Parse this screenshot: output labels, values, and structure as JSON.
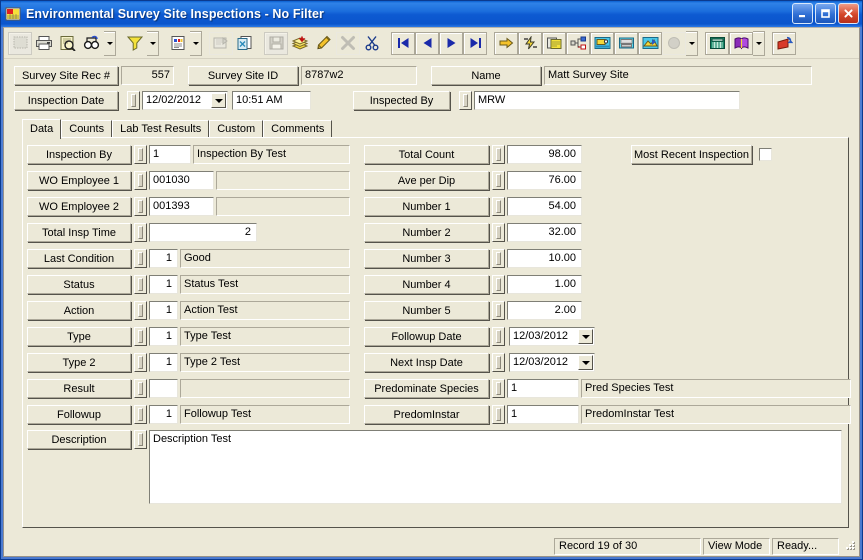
{
  "window": {
    "title": "Environmental Survey Site Inspections - No Filter",
    "app_icon": "app-window-icon",
    "minimize_label": "Minimize",
    "maximize_label": "Maximize",
    "close_label": "Close"
  },
  "toolbar": {
    "buttons": [
      {
        "name": "new-record-icon",
        "glyph": "blank-page",
        "disabled": true
      },
      {
        "name": "print-icon",
        "glyph": "printer",
        "disabled": false
      },
      {
        "name": "print-preview-icon",
        "glyph": "preview",
        "disabled": false
      },
      {
        "name": "find-icon",
        "glyph": "binoculars",
        "disabled": false,
        "dropdown": true
      },
      {
        "name": "filter-icon",
        "glyph": "funnel",
        "disabled": false,
        "dropdown": true
      },
      {
        "name": "report-icon",
        "glyph": "report",
        "disabled": false,
        "dropdown": true
      },
      {
        "name": "form-design-icon",
        "glyph": "form",
        "disabled": true
      },
      {
        "name": "copy-record-icon",
        "glyph": "copy-page",
        "disabled": false
      },
      {
        "name": "save-icon",
        "glyph": "diskette",
        "disabled": true
      },
      {
        "name": "post-icon",
        "glyph": "stack-post",
        "disabled": false
      },
      {
        "name": "edit-icon",
        "glyph": "pencil",
        "disabled": false
      },
      {
        "name": "delete-icon",
        "glyph": "x-mark",
        "disabled": true
      },
      {
        "name": "cut-icon",
        "glyph": "scissors",
        "disabled": false
      },
      {
        "name": "first-record-icon",
        "glyph": "first",
        "disabled": false
      },
      {
        "name": "previous-record-icon",
        "glyph": "prev",
        "disabled": false
      },
      {
        "name": "next-record-icon",
        "glyph": "next",
        "disabled": false
      },
      {
        "name": "last-record-icon",
        "glyph": "last",
        "disabled": false
      },
      {
        "name": "goto-icon",
        "glyph": "yellow-arrow",
        "disabled": false
      },
      {
        "name": "quick-action-icon",
        "glyph": "lightning",
        "disabled": false
      },
      {
        "name": "map-icon",
        "glyph": "map-pages",
        "disabled": false
      },
      {
        "name": "hierarchy-icon",
        "glyph": "tree-nodes",
        "disabled": false
      },
      {
        "name": "workorder-icon",
        "glyph": "workorder",
        "disabled": false
      },
      {
        "name": "phone-icon",
        "glyph": "telephone",
        "disabled": false
      },
      {
        "name": "gis-icon",
        "glyph": "gis-picture",
        "disabled": false
      },
      {
        "name": "globe-icon",
        "glyph": "globe",
        "disabled": true,
        "dropdown": true
      },
      {
        "name": "calculator-icon",
        "glyph": "calculator",
        "disabled": false
      },
      {
        "name": "help-book-icon",
        "glyph": "book",
        "disabled": false,
        "dropdown": true
      },
      {
        "name": "exit-icon",
        "glyph": "exit-door",
        "disabled": false
      }
    ]
  },
  "header": {
    "rec_label": "Survey Site Rec #",
    "rec_value": "557",
    "site_id_label": "Survey Site ID",
    "site_id_value": "8787w2",
    "name_label": "Name",
    "name_value": "Matt Survey Site",
    "inspection_date_label": "Inspection Date",
    "inspection_date_value": "12/02/2012",
    "inspection_time_value": "10:51 AM",
    "inspected_by_label": "Inspected By",
    "inspected_by_value": "MRW"
  },
  "tabs": [
    {
      "label": "Data",
      "active": true
    },
    {
      "label": "Counts",
      "active": false
    },
    {
      "label": "Lab Test Results",
      "active": false
    },
    {
      "label": "Custom",
      "active": false
    },
    {
      "label": "Comments",
      "active": false
    }
  ],
  "left_fields": [
    {
      "label": "Inspection By",
      "code": "1",
      "code_align": "left",
      "desc": "Inspection By Test",
      "desc_style": "sunken"
    },
    {
      "label": "WO Employee 1",
      "code": "001030",
      "code_align": "left",
      "desc": "",
      "desc_style": "sunken",
      "wide_code": true
    },
    {
      "label": "WO Employee 2",
      "code": "001393",
      "code_align": "left",
      "desc": "",
      "desc_style": "sunken",
      "wide_code": true
    },
    {
      "label": "Total Insp Time",
      "code": "2",
      "code_align": "right",
      "desc": null,
      "desc_style": "none",
      "single": true
    },
    {
      "label": "Last Condition",
      "code": "1",
      "code_align": "right",
      "desc": "Good",
      "desc_style": "sunken"
    },
    {
      "label": "Status",
      "code": "1",
      "code_align": "right",
      "desc": "Status Test",
      "desc_style": "sunken"
    },
    {
      "label": "Action",
      "code": "1",
      "code_align": "right",
      "desc": "Action Test",
      "desc_style": "sunken"
    },
    {
      "label": "Type",
      "code": "1",
      "code_align": "right",
      "desc": "Type Test",
      "desc_style": "sunken"
    },
    {
      "label": "Type 2",
      "code": "1",
      "code_align": "right",
      "desc": "Type 2 Test",
      "desc_style": "sunken"
    },
    {
      "label": "Result",
      "code": "",
      "code_align": "right",
      "desc": "",
      "desc_style": "sunken"
    },
    {
      "label": "Followup",
      "code": "1",
      "code_align": "right",
      "desc": "Followup Test",
      "desc_style": "sunken"
    }
  ],
  "right_fields": [
    {
      "label": "Total Count",
      "kind": "number",
      "value": "98.00"
    },
    {
      "label": "Ave per Dip",
      "kind": "number",
      "value": "76.00"
    },
    {
      "label": "Number 1",
      "kind": "number",
      "value": "54.00"
    },
    {
      "label": "Number 2",
      "kind": "number",
      "value": "32.00"
    },
    {
      "label": "Number 3",
      "kind": "number",
      "value": "10.00"
    },
    {
      "label": "Number 4",
      "kind": "number",
      "value": "1.00"
    },
    {
      "label": "Number 5",
      "kind": "number",
      "value": "2.00"
    },
    {
      "label": "Followup Date",
      "kind": "date",
      "value": "12/03/2012"
    },
    {
      "label": "Next Insp Date",
      "kind": "date",
      "value": "12/03/2012"
    },
    {
      "label": "Predominate Species",
      "kind": "lookup",
      "value": "1",
      "desc": "Pred Species Test"
    },
    {
      "label": "PredomInstar",
      "kind": "lookup",
      "value": "1",
      "desc": "PredomInstar Test"
    }
  ],
  "most_recent": {
    "label": "Most Recent Inspection",
    "checked": false
  },
  "description": {
    "label": "Description",
    "value": "Description Test"
  },
  "statusbar": {
    "record": "Record 19 of 30",
    "mode": "View Mode",
    "state": "Ready..."
  }
}
